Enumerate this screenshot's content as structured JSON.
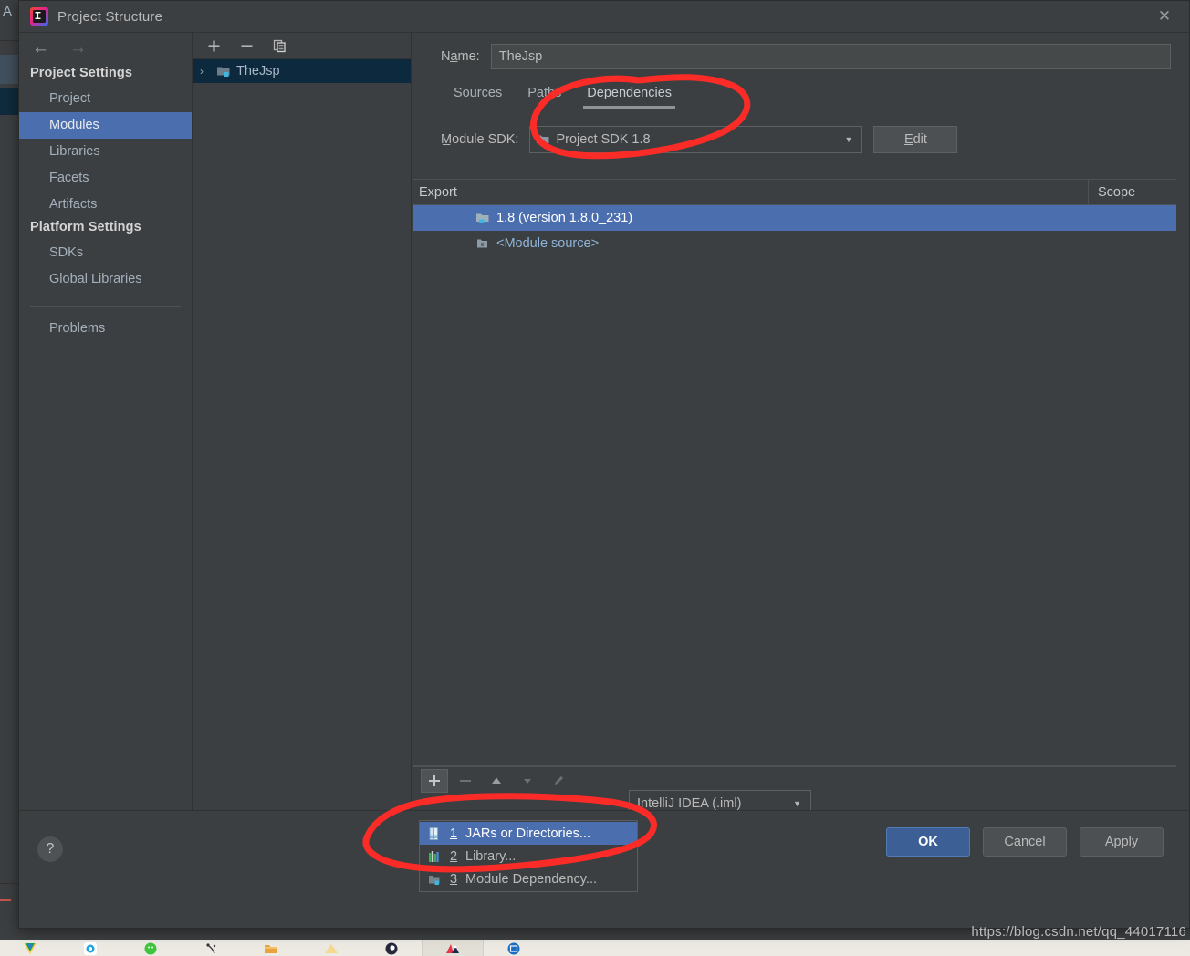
{
  "window": {
    "title": "Project Structure",
    "close_label": "✕",
    "app_icon": "intellij-idea-logo"
  },
  "background": {
    "edge_letter": "A"
  },
  "nav": {
    "back_label": "←",
    "forward_label": "→",
    "groups": [
      {
        "title": "Project Settings",
        "items": [
          {
            "label": "Project",
            "selected": false
          },
          {
            "label": "Modules",
            "selected": true
          },
          {
            "label": "Libraries",
            "selected": false
          },
          {
            "label": "Facets",
            "selected": false
          },
          {
            "label": "Artifacts",
            "selected": false
          }
        ]
      },
      {
        "title": "Platform Settings",
        "items": [
          {
            "label": "SDKs",
            "selected": false
          },
          {
            "label": "Global Libraries",
            "selected": false
          }
        ]
      }
    ],
    "problems_label": "Problems"
  },
  "tree": {
    "toolbar": {
      "add_label": "+",
      "remove_label": "−",
      "copy_label": "copy-icon"
    },
    "nodes": [
      {
        "label": "TheJsp",
        "expand_label": "›",
        "selected": true,
        "icon": "module-folder-icon"
      }
    ]
  },
  "detail": {
    "name_label": "Na̲me:",
    "name_value": "TheJsp",
    "name_placeholder": "",
    "tabs": [
      {
        "label": "Sources",
        "active": false
      },
      {
        "label": "Paths",
        "active": false
      },
      {
        "label": "Dependencies",
        "active": true
      }
    ],
    "sdk_label": "M̲odule SDK:",
    "sdk_value": "Project SDK 1.8",
    "sdk_icon": "java-sdk-icon",
    "edit_button": "Edit",
    "edit_mnemonic": "E",
    "table": {
      "columns": [
        "Export",
        "",
        "Scope"
      ],
      "rows": [
        {
          "name": "1.8 (version 1.8.0_231)",
          "scope": "",
          "export": false,
          "selected": true,
          "icon": "java-sdk-icon",
          "link": false
        },
        {
          "name": "<Module source>",
          "scope": "",
          "export": false,
          "selected": false,
          "icon": "module-source-icon",
          "link": true
        }
      ]
    },
    "dep_toolbar": {
      "add_label": "+",
      "remove_label": "−",
      "up_label": "▲",
      "down_label": "▼",
      "edit_label": "✦"
    },
    "iml_combo_value": "IntelliJ IDEA (.iml)"
  },
  "add_menu": {
    "items": [
      {
        "num": "1",
        "label": "JARs or Directories...",
        "icon": "jar-file-icon",
        "selected": true
      },
      {
        "num": "2",
        "label": "Library...",
        "icon": "library-icon",
        "selected": false
      },
      {
        "num": "3",
        "label": "Module Dependency...",
        "icon": "module-folder-icon",
        "selected": false
      }
    ]
  },
  "footer": {
    "help_label": "?",
    "buttons": [
      {
        "label": "OK",
        "mnemonic": "",
        "primary": true
      },
      {
        "label": "Cancel",
        "mnemonic": "",
        "primary": false
      },
      {
        "label": "Apply",
        "mnemonic": "A",
        "primary": false
      }
    ]
  },
  "watermark": {
    "text": "https://blog.csdn.net/qq_44017116"
  },
  "colors": {
    "dialog_bg": "#3c3f41",
    "selection_blue": "#4b6eaf",
    "tree_selection": "#0d293e",
    "text_primary": "#bbbbbb",
    "text_link": "#8fb3d9",
    "annotation_red": "#fb2c27",
    "ok_button": "#3c6096"
  },
  "annotations": {
    "ellipse_tab_note": "red-circle-around-dependencies-tab",
    "ellipse_menu_note": "red-circle-around-add-menu-items"
  },
  "taskbar": {
    "items": [
      "wps-icon",
      "browser-icon",
      "wechat-icon",
      "music-icon",
      "folder-icon",
      "star-icon",
      "dark-app-icon",
      "photo-app-icon",
      "editor-icon"
    ]
  }
}
